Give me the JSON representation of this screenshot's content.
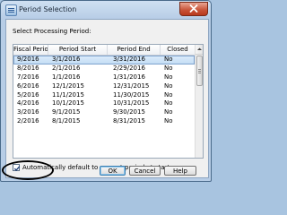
{
  "window": {
    "title": "Period Selection",
    "close_icon": "close-x-icon"
  },
  "dialog": {
    "prompt": "Select Processing Period:",
    "columns": [
      "Fiscal Perio",
      "Period Start",
      "Period End",
      "Closed"
    ],
    "rows": [
      {
        "fiscal": "9/2016",
        "start": "3/1/2016",
        "end": "3/31/2016",
        "closed": "No",
        "selected": true
      },
      {
        "fiscal": "8/2016",
        "start": "2/1/2016",
        "end": "2/29/2016",
        "closed": "No"
      },
      {
        "fiscal": "7/2016",
        "start": "1/1/2016",
        "end": "1/31/2016",
        "closed": "No"
      },
      {
        "fiscal": "6/2016",
        "start": "12/1/2015",
        "end": "12/31/2015",
        "closed": "No"
      },
      {
        "fiscal": "5/2016",
        "start": "11/1/2015",
        "end": "11/30/2015",
        "closed": "No"
      },
      {
        "fiscal": "4/2016",
        "start": "10/1/2015",
        "end": "10/31/2015",
        "closed": "No"
      },
      {
        "fiscal": "3/2016",
        "start": "9/1/2015",
        "end": "9/30/2015",
        "closed": "No"
      },
      {
        "fiscal": "2/2016",
        "start": "8/1/2015",
        "end": "8/31/2015",
        "closed": "No"
      }
    ],
    "checkbox_label": "Automatically default to current period at startup",
    "checkbox_checked": true,
    "buttons": {
      "ok": "OK",
      "cancel": "Cancel",
      "help": "Help"
    }
  },
  "colors": {
    "accent": "#3c7fb1",
    "selected_row": "#c2dcf3",
    "close_button": "#c75136",
    "annotation": "#000000"
  }
}
